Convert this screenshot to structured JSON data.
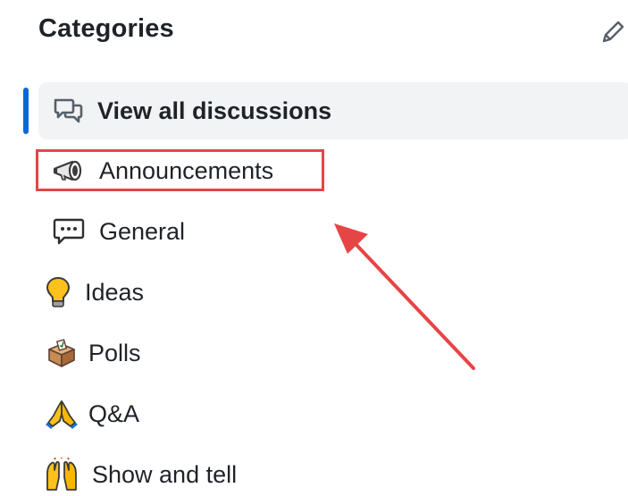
{
  "sidebar": {
    "title": "Categories",
    "edit_icon": "pencil-icon",
    "active_index": 0,
    "items": [
      {
        "label": "View all discussions",
        "icon": "discussions-icon"
      },
      {
        "label": "Announcements",
        "icon": "megaphone-icon"
      },
      {
        "label": "General",
        "icon": "speech-balloon-icon"
      },
      {
        "label": "Ideas",
        "icon": "lightbulb-icon"
      },
      {
        "label": "Polls",
        "icon": "ballot-box-icon"
      },
      {
        "label": "Q&A",
        "icon": "folded-hands-icon"
      },
      {
        "label": "Show and tell",
        "icon": "raised-hands-icon"
      }
    ]
  },
  "annotation": {
    "highlight_color": "#e64545",
    "target": "Announcements"
  },
  "colors": {
    "accent": "#0969da",
    "active_bg": "#f1f3f5",
    "text": "#1f2328"
  }
}
